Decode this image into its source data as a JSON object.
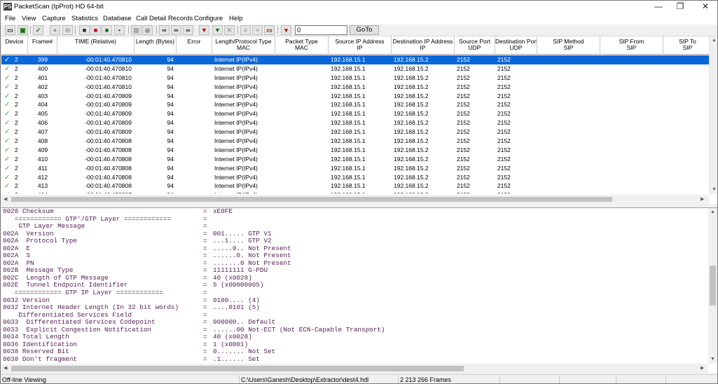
{
  "window": {
    "title": "PacketScan (IpProt) HD 64-bit",
    "app_icon": "PS",
    "minimize_glyph": "—",
    "maximize_glyph": "❐",
    "close_glyph": "✕"
  },
  "menu": [
    "File",
    "View",
    "Capture",
    "Statistics",
    "Database",
    "Call Detail Records",
    "Configure",
    "Help"
  ],
  "toolbar": {
    "goto_value": "0",
    "goto_label": "GoTo",
    "icons": [
      "open-folder-icon",
      "open-capture-icon",
      "filter-check-icon",
      "record-icon",
      "stop-icon",
      "interface-green-icon",
      "interface-red-icon",
      "interface-both-icon",
      "save-icon",
      "table-icon",
      "globe-icon",
      "binoculars-icon",
      "binoculars-next-icon",
      "binoculars-prev-icon",
      "set-filter-icon",
      "filter-icon",
      "clear-filter-icon",
      "export-csv-icon",
      "export-txt-icon",
      "export-pdf-icon",
      "highlight-icon"
    ]
  },
  "table": {
    "columns": [
      [
        "Device",
        ""
      ],
      [
        "Frame#",
        ""
      ],
      [
        "TIME (Relative)",
        ""
      ],
      [
        "Length (Bytes)",
        ""
      ],
      [
        "Error",
        ""
      ],
      [
        "Length/Protocol Type",
        "MAC"
      ],
      [
        "Packet Type",
        "MAC"
      ],
      [
        "Source IP Address",
        "IP"
      ],
      [
        "Destination IP Address",
        "IP"
      ],
      [
        "Source Port",
        "UDP"
      ],
      [
        "Destination Port",
        "UDP"
      ],
      [
        "SIP Method",
        "SIP"
      ],
      [
        "SIP From",
        "SIP"
      ],
      [
        "SIP To",
        "SIP"
      ]
    ],
    "rows": [
      [
        "2",
        "399",
        "-00:01:40.470810",
        "94",
        "",
        "Internet IP(IPv4)",
        "",
        "192.168.15.1",
        "192.168.15.2",
        "2152",
        "2152"
      ],
      [
        "2",
        "400",
        "-00:01:40.470810",
        "94",
        "",
        "Internet IP(IPv4)",
        "",
        "192.168.15.1",
        "192.168.15.2",
        "2152",
        "2152"
      ],
      [
        "2",
        "401",
        "-00:01:40.470810",
        "94",
        "",
        "Internet IP(IPv4)",
        "",
        "192.168.15.1",
        "192.168.15.2",
        "2152",
        "2152"
      ],
      [
        "2",
        "402",
        "-00:01:40.470810",
        "94",
        "",
        "Internet IP(IPv4)",
        "",
        "192.168.15.1",
        "192.168.15.2",
        "2152",
        "2152"
      ],
      [
        "2",
        "403",
        "-00:01:40.470809",
        "94",
        "",
        "Internet IP(IPv4)",
        "",
        "192.168.15.1",
        "192.168.15.2",
        "2152",
        "2152"
      ],
      [
        "2",
        "404",
        "-00:01:40.470809",
        "94",
        "",
        "Internet IP(IPv4)",
        "",
        "192.168.15.1",
        "192.168.15.2",
        "2152",
        "2152"
      ],
      [
        "2",
        "405",
        "-00:01:40.470809",
        "94",
        "",
        "Internet IP(IPv4)",
        "",
        "192.168.15.1",
        "192.168.15.2",
        "2152",
        "2152"
      ],
      [
        "2",
        "406",
        "-00:01:40.470809",
        "94",
        "",
        "Internet IP(IPv4)",
        "",
        "192.168.15.1",
        "192.168.15.2",
        "2152",
        "2152"
      ],
      [
        "2",
        "407",
        "-00:01:40.470809",
        "94",
        "",
        "Internet IP(IPv4)",
        "",
        "192.168.15.1",
        "192.168.15.2",
        "2152",
        "2152"
      ],
      [
        "2",
        "408",
        "-00:01:40.470808",
        "94",
        "",
        "Internet IP(IPv4)",
        "",
        "192.168.15.1",
        "192.168.15.2",
        "2152",
        "2152"
      ],
      [
        "2",
        "409",
        "-00:01:40.470808",
        "94",
        "",
        "Internet IP(IPv4)",
        "",
        "192.168.15.1",
        "192.168.15.2",
        "2152",
        "2152"
      ],
      [
        "2",
        "410",
        "-00:01:40.470808",
        "94",
        "",
        "Internet IP(IPv4)",
        "",
        "192.168.15.1",
        "192.168.15.2",
        "2152",
        "2152"
      ],
      [
        "2",
        "411",
        "-00:01:40.470808",
        "94",
        "",
        "Internet IP(IPv4)",
        "",
        "192.168.15.1",
        "192.168.15.2",
        "2152",
        "2152"
      ],
      [
        "2",
        "412",
        "-00:01:40.470808",
        "94",
        "",
        "Internet IP(IPv4)",
        "",
        "192.168.15.1",
        "192.168.15.2",
        "2152",
        "2152"
      ],
      [
        "2",
        "413",
        "-00:01:40.470808",
        "94",
        "",
        "Internet IP(IPv4)",
        "",
        "192.168.15.1",
        "192.168.15.2",
        "2152",
        "2152"
      ],
      [
        "2",
        "414",
        "-00:01:40.470807",
        "94",
        "",
        "Internet IP(IPv4)",
        "",
        "192.168.15.1",
        "192.168.15.2",
        "2152",
        "2152"
      ]
    ],
    "selected_frame": "399",
    "check_glyph": "✓",
    "selected_color": "#0a67d8"
  },
  "decode_lines": [
    [
      "0028 Checksum",
      "=",
      "xE0FE"
    ],
    [
      "   ============ GTP'/GTP Layer ============",
      "=",
      ""
    ],
    [
      "    GTP Layer Message",
      "=",
      ""
    ],
    [
      "002A  Version",
      "=",
      "001..... GTP V1"
    ],
    [
      "002A  Protocol Type",
      "=",
      "...1.... GTP V2"
    ],
    [
      "002A  E",
      "=",
      ".....0.. Not Present"
    ],
    [
      "002A  S",
      "=",
      "......0. Not Present"
    ],
    [
      "002A  PN",
      "=",
      ".......0 Not Present"
    ],
    [
      "002B  Message Type",
      "=",
      "11111111 G-PDU"
    ],
    [
      "002C  Length of GTP Message",
      "=",
      "40 (x0028)"
    ],
    [
      "002E  Tunnel Endpoint Identifier",
      "=",
      "5 (x00000005)"
    ],
    [
      "   ============ GTP IP Layer ============",
      "=",
      ""
    ],
    [
      "0032 Version",
      "=",
      "0100.... (4)"
    ],
    [
      "0032 Internet Header Length (In 32 bit words)",
      "=",
      "....0101 (5)"
    ],
    [
      "    Differentiated Services Field",
      "=",
      ""
    ],
    [
      "0033  Differentiated Services Codepoint",
      "=",
      "000000.. Default"
    ],
    [
      "0033  Explicit Congestion Notification",
      "=",
      "......00 Not-ECT (Not ECN-Capable Transport)"
    ],
    [
      "0034 Total Length",
      "=",
      "40 (x0028)"
    ],
    [
      "0036 Identification",
      "=",
      "1 (x0001)"
    ],
    [
      "0038 Reserved Bit",
      "=",
      "0....... Not Set"
    ],
    [
      "0038 Don't fragment",
      "=",
      ".1...... Set"
    ]
  ],
  "status": {
    "mode": "Off-line Viewing",
    "file_path": "C:\\Users\\Ganesh\\Desktop\\Extractor\\dest4.hdl",
    "frames": "2 213 266 Frames"
  },
  "decode_text_color": "#552255"
}
